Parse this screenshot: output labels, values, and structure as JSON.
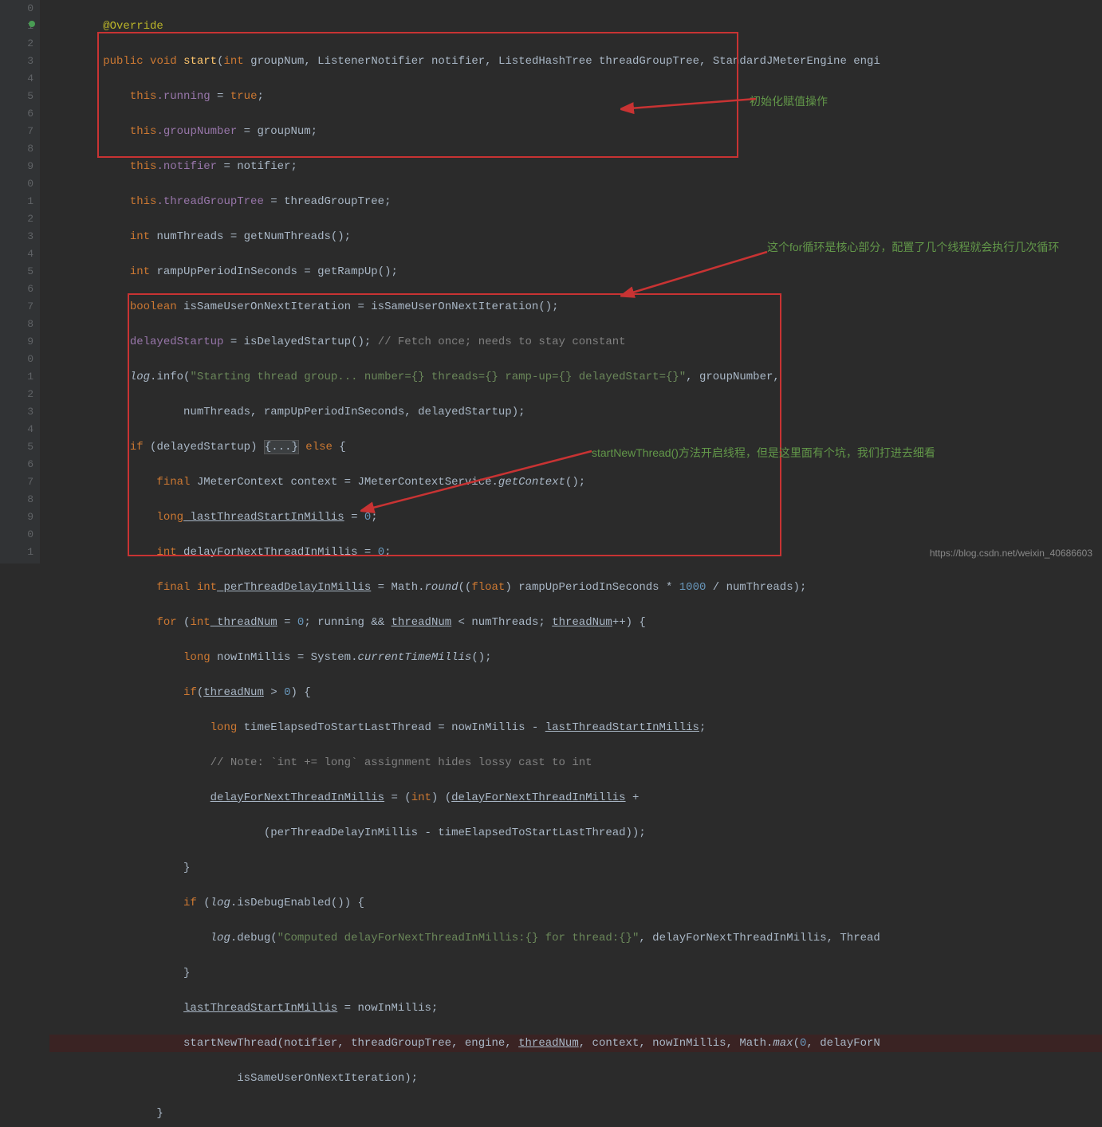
{
  "gutter_start_partial": [
    "0",
    "1",
    "2",
    "3",
    "4",
    "5",
    "6",
    "7",
    "8",
    "9",
    "0",
    "1",
    "2",
    "3",
    "4",
    "5",
    "6",
    "7",
    "8",
    "9",
    "0",
    "1",
    "2",
    "3",
    "4",
    "5",
    "6",
    "7",
    "8",
    "9",
    "0",
    "1"
  ],
  "code": {
    "l0": "@Override",
    "l1_public": "public",
    "l1_void": "void",
    "l1_start": "start",
    "l1_int": "int",
    "l1_paren_open": "(",
    "l1_groupNum": "groupNum,",
    "l1_ListenerNotifier": "ListenerNotifier notifier, ListedHashTree threadGroupTree, StandardJMeterEngine engi",
    "l2_this": "this",
    "l2_running": ".running",
    "l2_eq_true": " = ",
    "l2_true": "true",
    "l2_semi": ";",
    "l3_this": "this",
    "l3_groupNumber": ".groupNumber",
    "l3_eq": " = groupNum;",
    "l4_this": "this",
    "l4_notifier": ".notifier",
    "l4_eq": " = notifier;",
    "l5_this": "this",
    "l5_tgt": ".threadGroupTree",
    "l5_eq": " = threadGroupTree;",
    "l6_int": "int",
    "l6_numThreads": " numThreads = getNumThreads();",
    "l7_int": "int",
    "l7_ramp": " rampUpPeriodInSeconds = getRampUp();",
    "l8_boolean": "boolean",
    "l8_same": " isSameUserOnNextIteration = isSameUserOnNextIteration();",
    "l9_delayed": "delayedStartup",
    "l9_eq": " = isDelayedStartup(); ",
    "l9_comment": "// Fetch once; needs to stay constant",
    "l10_log": "log",
    "l10_info": ".info(",
    "l10_str": "\"Starting thread group... number={} threads={} ramp-up={} delayedStart={}\"",
    "l10_args": ", groupNumber,",
    "l11_args": "numThreads, rampUpPeriodInSeconds, delayedStartup);",
    "l12_if": "if",
    "l12_cond": " (delayedStartup) ",
    "l12_fold": "{...}",
    "l12_else": " else",
    "l12_brace": " {",
    "l13_final": "final",
    "l13_ctx": " JMeterContext context = JMeterContextService.",
    "l13_getCtx": "getContext",
    "l13_paren": "();",
    "l14_long": "long",
    "l14_last": " lastThreadStartInMillis",
    "l14_eq": " = ",
    "l14_zero": "0",
    "l14_semi": ";",
    "l15_int": "int",
    "l15_delay": " delayForNextThreadInMillis",
    "l15_eq": " = ",
    "l15_zero": "0",
    "l15_semi": ";",
    "l16_final": "final int",
    "l16_per": " perThreadDelayInMillis",
    "l16_eq": " = Math.",
    "l16_round": "round",
    "l16_cast": "((",
    "l16_float": "float",
    "l16_expr": ") rampUpPeriodInSeconds * ",
    "l16_1000": "1000",
    "l16_div": " / numThreads);",
    "l17_for": "for",
    "l17_open": " (",
    "l17_int": "int",
    "l17_tn": " threadNum",
    "l17_eq": " = ",
    "l17_zero": "0",
    "l17_semi": "; running && ",
    "l17_tn2": "threadNum",
    "l17_lt": " < numThreads; ",
    "l17_tn3": "threadNum",
    "l17_inc": "++) {",
    "l18_long": "long",
    "l18_now": " nowInMillis = System.",
    "l18_ctm": "currentTimeMillis",
    "l18_paren": "();",
    "l19_if": "if",
    "l19_open": "(",
    "l19_tn": "threadNum",
    "l19_gt": " > ",
    "l19_zero": "0",
    "l19_close": ") {",
    "l20_long": "long",
    "l20_elapsed": " timeElapsedToStartLastThread = nowInMillis - ",
    "l20_last": "lastThreadStartInMillis",
    "l20_semi": ";",
    "l21_comment": "// Note: `int += long` assignment hides lossy cast to int",
    "l22_delay": "delayForNextThreadInMillis",
    "l22_eq": " = (",
    "l22_int": "int",
    "l22_cast": ") (",
    "l22_delay2": "delayForNextThreadInMillis",
    "l22_plus": " +",
    "l23_expr": "(perThreadDelayInMillis - timeElapsedToStartLastThread));",
    "l24_brace": "}",
    "l25_if": "if",
    "l25_cond": " (",
    "l25_log": "log",
    "l25_debug": ".isDebugEnabled()) {",
    "l26_log": "log",
    "l26_debug": ".debug(",
    "l26_str": "\"Computed delayForNextThreadInMillis:{} for thread:{}\"",
    "l26_args": ", delayForNextThreadInMillis, Thread",
    "l27_brace": "}",
    "l28_last": "lastThreadStartInMillis",
    "l28_eq": " = nowInMillis;",
    "l29_snt": "startNewThread(notifier, threadGroupTree, engine, ",
    "l29_tn": "threadNum",
    "l29_rest": ", context, nowInMillis, Math.",
    "l29_max": "max",
    "l29_open": "(",
    "l29_zero": "0",
    "l29_comma": ", delayForN",
    "l30_args": "isSameUserOnNextIteration);",
    "l31_brace": "}"
  },
  "annotations": {
    "a1": "初始化赋值操作",
    "a2": "这个for循环是核心部分，配置了几个线程就会执行几次循环",
    "a3": "startNewThread()方法开启线程，但是这里面有个坑，我们打进去细看"
  },
  "watermark": "https://blog.csdn.net/weixin_40686603"
}
